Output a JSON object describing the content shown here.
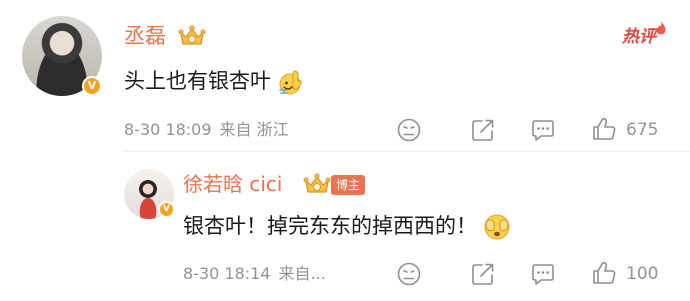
{
  "comment": {
    "user_name": "丞磊",
    "text": "头上也有银杏叶",
    "date": "8-30 18:09",
    "source": "来自 浙江",
    "hot_label": "热评",
    "likes": "675",
    "emoji_icon": "raised-hand-emoji-icon"
  },
  "reply": {
    "user_name": "徐若晗 cici",
    "author_badge": "博主",
    "text": "银杏叶！掉完东东的掉西西的！",
    "date": "8-30 18:14",
    "source": "来自...",
    "likes": "100",
    "emoji_icon": "face-with-hands-emoji-icon"
  },
  "colors": {
    "name": "#eb7350",
    "meta": "#939393",
    "hot": "#e2463f",
    "verified": "#f7a21c"
  }
}
